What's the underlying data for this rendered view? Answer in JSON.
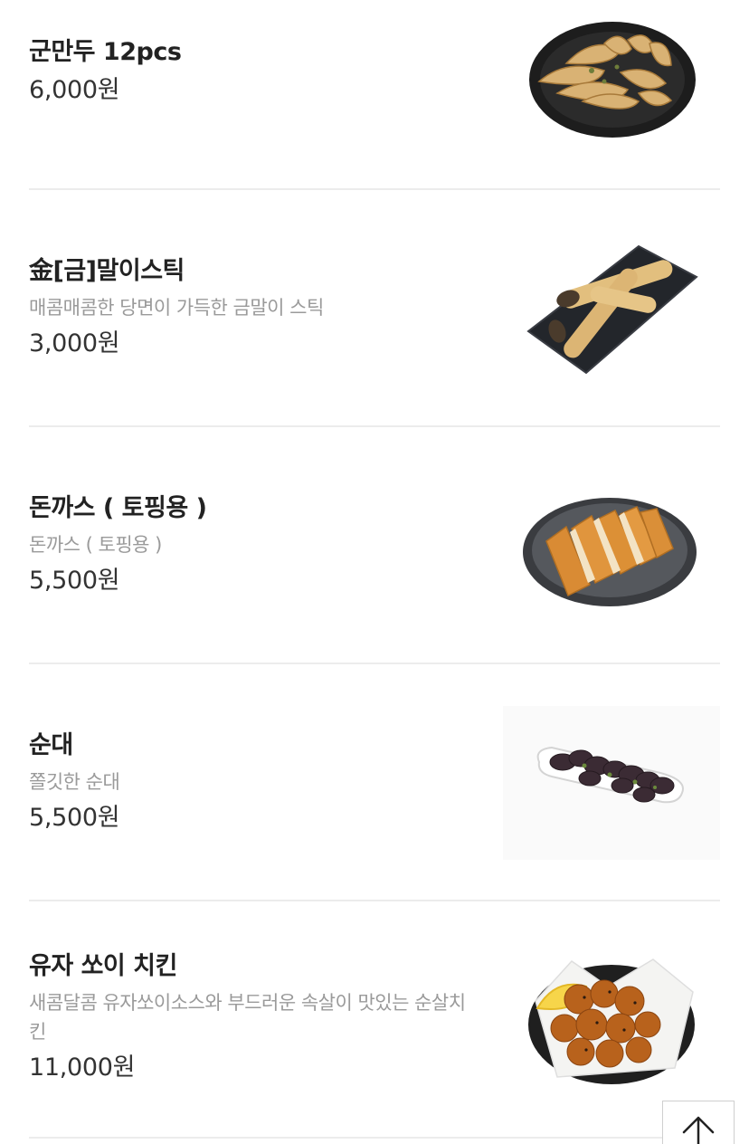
{
  "menu": {
    "items": [
      {
        "name": "군만두 12pcs",
        "description": "",
        "price": "6,000원",
        "image_icon": "fried-dumplings-photo"
      },
      {
        "name": "金[금]말이스틱",
        "description": "매콤매콤한 당면이 가득한 금말이 스틱",
        "price": "3,000원",
        "image_icon": "gold-roll-stick-photo"
      },
      {
        "name": "돈까스 ( 토핑용 )",
        "description": "돈까스 ( 토핑용 )",
        "price": "5,500원",
        "image_icon": "pork-cutlet-photo"
      },
      {
        "name": "순대",
        "description": "쫄깃한 순대",
        "price": "5,500원",
        "image_icon": "sundae-photo"
      },
      {
        "name": "유자 쏘이 치킨",
        "description": "새콤달콤 유자쏘이소스와 부드러운 속살이 맛있는 순살치킨",
        "price": "11,000원",
        "image_icon": "yuzu-soy-chicken-photo"
      }
    ]
  },
  "scroll_top": {
    "icon": "arrow-up-icon"
  },
  "colors": {
    "text": "#222222",
    "description": "#9a9a9a",
    "divider": "#ececec",
    "background": "#ffffff"
  }
}
